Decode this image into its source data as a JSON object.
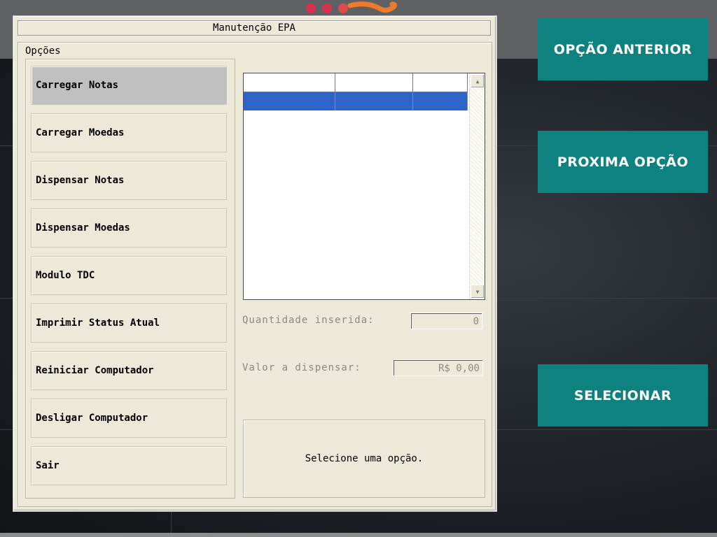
{
  "window": {
    "title": "Manutenção EPA"
  },
  "options_group": {
    "label": "Opções"
  },
  "menu": [
    {
      "label": "Carregar Notas",
      "selected": true
    },
    {
      "label": "Carregar Moedas",
      "selected": false
    },
    {
      "label": "Dispensar Notas",
      "selected": false
    },
    {
      "label": "Dispensar Moedas",
      "selected": false
    },
    {
      "label": "Modulo TDC",
      "selected": false
    },
    {
      "label": "Imprimir Status Atual",
      "selected": false
    },
    {
      "label": "Reiniciar Computador",
      "selected": false
    },
    {
      "label": "Desligar Computador",
      "selected": false
    },
    {
      "label": "Sair",
      "selected": false
    }
  ],
  "fields": {
    "quantity_label": "Quantidade inserida:",
    "quantity_value": "0",
    "amount_label": "Valor a dispensar:",
    "amount_value": "R$ 0,00"
  },
  "status": {
    "message": "Selecione uma opção."
  },
  "side_buttons": {
    "previous": "OPÇÃO ANTERIOR",
    "next": "PROXIMA OPÇÃO",
    "select": "SELECIONAR"
  },
  "colors": {
    "side_button": "#0e8181",
    "dialog_bg": "#ece9d8",
    "selection": "#2e64c8",
    "selected_menu": "#c0c0c0"
  },
  "icons": {
    "scroll_up": "scroll-up-arrow-icon",
    "scroll_down": "scroll-down-arrow-icon",
    "logo": "brand-logo"
  }
}
